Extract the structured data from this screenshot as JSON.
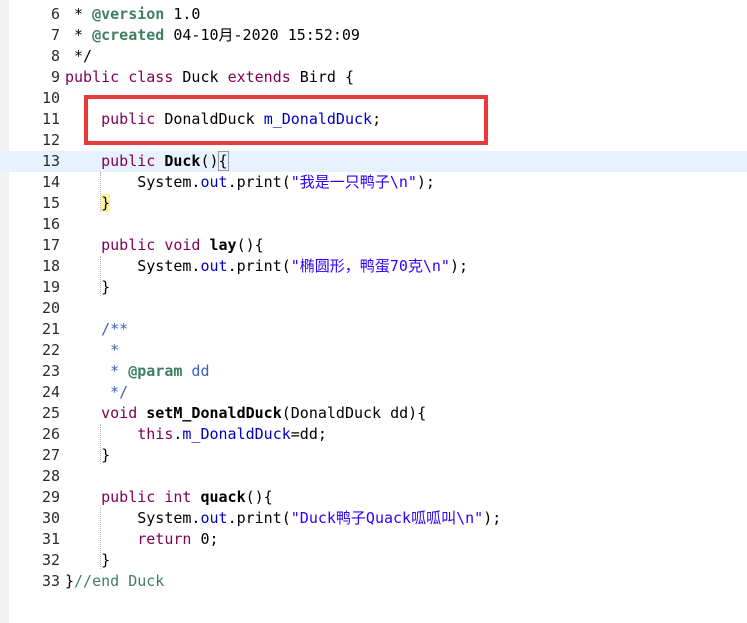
{
  "editor": {
    "lines": [
      {
        "num": "6",
        "t": [
          {
            "s": " * "
          },
          {
            "s": "@version",
            "c": "tag"
          },
          {
            "s": " 1.0"
          }
        ]
      },
      {
        "num": "7",
        "t": [
          {
            "s": " * "
          },
          {
            "s": "@created",
            "c": "tag"
          },
          {
            "s": " 04-10月-2020 15:52:09"
          }
        ]
      },
      {
        "num": "8",
        "t": [
          {
            "s": " */"
          }
        ]
      },
      {
        "num": "9",
        "t": [
          {
            "s": "public",
            "c": "kw"
          },
          {
            "s": " "
          },
          {
            "s": "class",
            "c": "kw"
          },
          {
            "s": " Duck "
          },
          {
            "s": "extends",
            "c": "kw"
          },
          {
            "s": " Bird {"
          }
        ]
      },
      {
        "num": "10",
        "t": []
      },
      {
        "num": "11",
        "t": [
          {
            "s": "    "
          },
          {
            "s": "public",
            "c": "kw"
          },
          {
            "s": " DonaldDuck "
          },
          {
            "s": "m_DonaldDuck",
            "c": "fld"
          },
          {
            "s": ";"
          }
        ]
      },
      {
        "num": "12",
        "t": []
      },
      {
        "num": "13",
        "current": true,
        "t": [
          {
            "s": "    "
          },
          {
            "s": "public",
            "c": "kw"
          },
          {
            "s": " "
          },
          {
            "s": "Duck",
            "c": "bold"
          },
          {
            "s": "()"
          },
          {
            "s": "{",
            "c": "bracket-hl"
          }
        ]
      },
      {
        "num": "14",
        "t": [
          {
            "s": "        System."
          },
          {
            "s": "out",
            "c": "fld"
          },
          {
            "s": ".print("
          },
          {
            "s": "\"我是一只鸭子\\n\"",
            "c": "str"
          },
          {
            "s": ");"
          }
        ]
      },
      {
        "num": "15",
        "t": [
          {
            "s": "    "
          },
          {
            "s": "}",
            "c": "brace-yellow"
          }
        ]
      },
      {
        "num": "16",
        "t": []
      },
      {
        "num": "17",
        "t": [
          {
            "s": "    "
          },
          {
            "s": "public",
            "c": "kw"
          },
          {
            "s": " "
          },
          {
            "s": "void",
            "c": "kw"
          },
          {
            "s": " "
          },
          {
            "s": "lay",
            "c": "bold"
          },
          {
            "s": "(){"
          }
        ]
      },
      {
        "num": "18",
        "t": [
          {
            "s": "        System."
          },
          {
            "s": "out",
            "c": "fld"
          },
          {
            "s": ".print("
          },
          {
            "s": "\"椭圆形，鸭蛋70克\\n\"",
            "c": "str"
          },
          {
            "s": ");"
          }
        ]
      },
      {
        "num": "19",
        "t": [
          {
            "s": "    }"
          }
        ]
      },
      {
        "num": "20",
        "t": []
      },
      {
        "num": "21",
        "t": [
          {
            "s": "    /**",
            "c": "jdoc"
          }
        ]
      },
      {
        "num": "22",
        "t": [
          {
            "s": "     *",
            "c": "jdoc"
          }
        ]
      },
      {
        "num": "23",
        "t": [
          {
            "s": "     * ",
            "c": "jdoc"
          },
          {
            "s": "@param",
            "c": "tag"
          },
          {
            "s": " dd",
            "c": "jdoc"
          }
        ]
      },
      {
        "num": "24",
        "t": [
          {
            "s": "     */",
            "c": "jdoc"
          }
        ]
      },
      {
        "num": "25",
        "t": [
          {
            "s": "    "
          },
          {
            "s": "void",
            "c": "kw"
          },
          {
            "s": " "
          },
          {
            "s": "setM_DonaldDuck",
            "c": "bold"
          },
          {
            "s": "(DonaldDuck dd){"
          }
        ]
      },
      {
        "num": "26",
        "t": [
          {
            "s": "        "
          },
          {
            "s": "this",
            "c": "kw"
          },
          {
            "s": "."
          },
          {
            "s": "m_DonaldDuck",
            "c": "fld"
          },
          {
            "s": "=dd;"
          }
        ]
      },
      {
        "num": "27",
        "t": [
          {
            "s": "    }"
          }
        ]
      },
      {
        "num": "28",
        "t": []
      },
      {
        "num": "29",
        "t": [
          {
            "s": "    "
          },
          {
            "s": "public",
            "c": "kw"
          },
          {
            "s": " "
          },
          {
            "s": "int",
            "c": "kw"
          },
          {
            "s": " "
          },
          {
            "s": "quack",
            "c": "bold"
          },
          {
            "s": "(){"
          }
        ]
      },
      {
        "num": "30",
        "t": [
          {
            "s": "        System."
          },
          {
            "s": "out",
            "c": "fld"
          },
          {
            "s": ".print("
          },
          {
            "s": "\"Duck鸭子Quack呱呱叫\\n\"",
            "c": "str"
          },
          {
            "s": ");"
          }
        ]
      },
      {
        "num": "31",
        "t": [
          {
            "s": "        "
          },
          {
            "s": "return",
            "c": "kw"
          },
          {
            "s": " 0;"
          }
        ]
      },
      {
        "num": "32",
        "t": [
          {
            "s": "    }"
          }
        ]
      },
      {
        "num": "33",
        "t": [
          {
            "s": "}"
          },
          {
            "s": "//end Duck",
            "c": "cmt"
          }
        ]
      }
    ]
  }
}
